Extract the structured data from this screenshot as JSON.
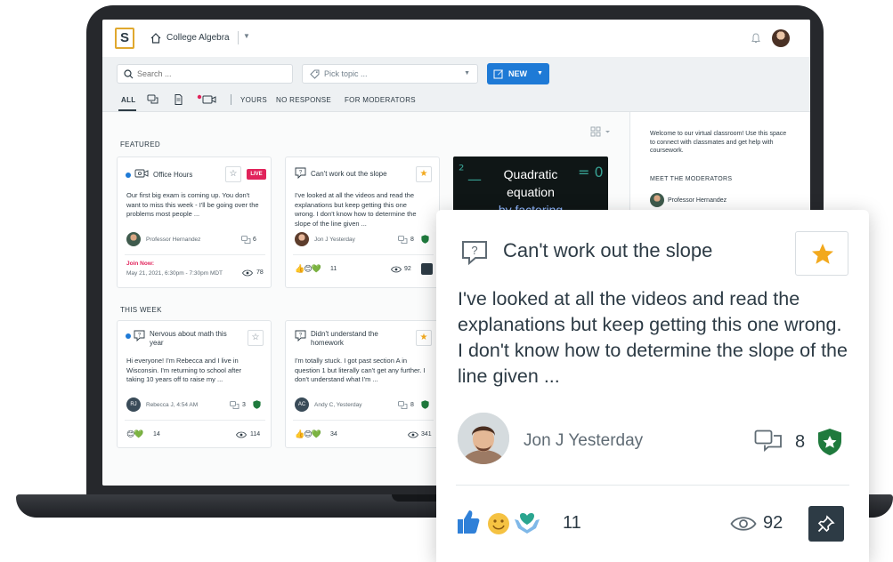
{
  "header": {
    "course_title": "College Algebra",
    "logo_letter": "S"
  },
  "filters": {
    "search_placeholder": "Search ...",
    "topic_placeholder": "Pick topic ...",
    "new_button_label": "NEW",
    "tabs": {
      "all": "ALL",
      "yours": "YOURS",
      "no_response": "NO RESPONSE",
      "for_moderators": "FOR MODERATORS"
    }
  },
  "feed": {
    "featured_label": "FEATURED",
    "this_week_label": "THIS WEEK",
    "cards": [
      {
        "title": "Office Hours",
        "badge": "LIVE",
        "body": "Our first big exam is coming up. You don't want to miss this week - I'll be going over the problems most people ...",
        "author": "Professor Hernandez",
        "comments": "6",
        "join_label": "Join Now:",
        "join_date": "May 21, 2021, 6:30pm - 7:30pm MDT",
        "views": "78"
      },
      {
        "title": "Can't work out the slope",
        "body": "I've looked at all the videos and read the explanations but keep getting this one wrong.  I don't know how to determine the slope of the line given ...",
        "author": "Jon J Yesterday",
        "comments": "8",
        "reactions": "11",
        "views": "92"
      },
      {
        "title": "Nervous about math this year",
        "body": "Hi everyone! I'm Rebecca and I live in Wisconsin.  I'm returning to school after taking 10 years off to raise my ...",
        "author_initials": "RJ",
        "author": "Rebecca J, 4:54 AM",
        "comments": "3",
        "reactions": "14",
        "views": "114"
      },
      {
        "title": "Didn't understand the homework",
        "body": "I'm totally stuck. I got past section A in question 1 but literally can't get any further. I don't understand what I'm ...",
        "author_initials": "AC",
        "author": "Andy C, Yesterday",
        "comments": "8",
        "reactions": "34",
        "views": "341"
      }
    ],
    "video": {
      "title_line1": "Quadratic",
      "title_line2": "equation",
      "title_line3": "by factoring"
    }
  },
  "side_panel": {
    "welcome_text": "Welcome to our virtual classroom! Use this space to connect with classmates and get help with coursework.",
    "moderators_heading": "MEET THE MODERATORS",
    "moderator_name": "Professor Hernandez"
  },
  "zoom_card": {
    "title": "Can't work out the slope",
    "body": "I've looked at all the videos and read the explanations but keep getting this one wrong.  I don't know how to determine the slope of the line given ...",
    "author": "Jon J Yesterday",
    "comments": "8",
    "reactions": "11",
    "views": "92"
  },
  "colors": {
    "accent_blue": "#1e7ad6",
    "live_red": "#e1235b",
    "star_gold": "#f2a91d",
    "moderator_green": "#1f7a3d",
    "text_dark": "#2d3b45"
  }
}
